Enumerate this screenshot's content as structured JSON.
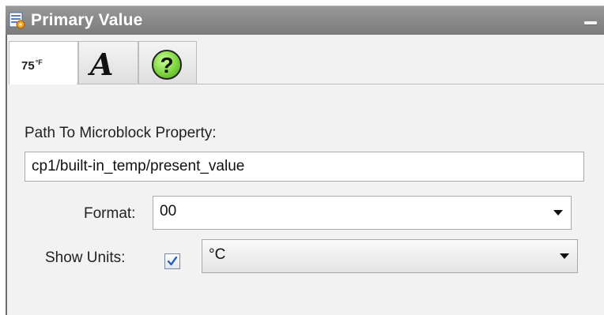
{
  "window": {
    "title": "Primary Value",
    "icon": "properties-icon",
    "minimize_icon": "minimize-icon"
  },
  "tabs": [
    {
      "label": "75",
      "unit": "°F",
      "name": "tab-value",
      "active": true
    },
    {
      "label": "𝒜",
      "name": "tab-font",
      "icon": "font-icon"
    },
    {
      "label": "?",
      "name": "tab-help",
      "icon": "help-icon"
    }
  ],
  "form": {
    "path_label": "Path To Microblock Property:",
    "path_value": "cp1/built-in_temp/present_value",
    "format_label": "Format:",
    "format_value": "00",
    "show_units_label": "Show Units:",
    "show_units_checked": true,
    "units_value": "°C"
  },
  "colors": {
    "titlebar": "#8a8a8a",
    "help_green": "#7bd43c",
    "checkbox_check": "#2c5fb8"
  }
}
